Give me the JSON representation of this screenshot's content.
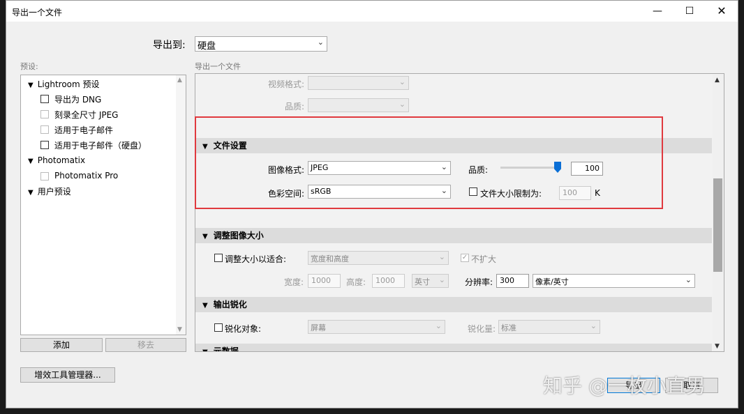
{
  "window": {
    "title": "导出一个文件",
    "minimize_icon": "minimize-icon",
    "maximize_icon": "maximize-icon",
    "close_icon": "close-icon"
  },
  "export_to": {
    "label": "导出到:",
    "value": "硬盘"
  },
  "presets": {
    "label": "预设:",
    "groups": [
      {
        "name": "Lightroom 预设",
        "items": [
          "导出为 DNG",
          "刻录全尺寸 JPEG",
          "适用于电子邮件",
          "适用于电子邮件（硬盘）"
        ]
      },
      {
        "name": "Photomatix",
        "items": [
          "Photomatix Pro"
        ]
      },
      {
        "name": "用户预设",
        "items": []
      }
    ],
    "add_button": "添加",
    "remove_button": "移去"
  },
  "settings": {
    "label": "导出一个文件",
    "video": {
      "format_label": "视频格式:",
      "quality_label": "品质:"
    },
    "file_settings": {
      "header": "文件设置",
      "image_format_label": "图像格式:",
      "image_format_value": "JPEG",
      "quality_label": "品质:",
      "quality_value": "100",
      "quality_level": 100,
      "color_space_label": "色彩空间:",
      "color_space_value": "sRGB",
      "limit_size_label": "文件大小限制为:",
      "limit_size_value": "100",
      "limit_size_unit": "K"
    },
    "resize": {
      "header": "调整图像大小",
      "fit_label": "调整大小以适合:",
      "fit_value": "宽度和高度",
      "dont_enlarge_label": "不扩大",
      "width_label": "宽度:",
      "width_value": "1000",
      "height_label": "高度:",
      "height_value": "1000",
      "unit_value": "英寸",
      "resolution_label": "分辨率:",
      "resolution_value": "300",
      "resolution_unit": "像素/英寸"
    },
    "sharpen": {
      "header": "输出锐化",
      "target_label": "锐化对象:",
      "target_value": "屏幕",
      "amount_label": "锐化量:",
      "amount_value": "标准"
    },
    "metadata": {
      "header": "元数据"
    }
  },
  "plugin_manager_button": "增效工具管理器...",
  "export_button": "导出",
  "cancel_button": "取消",
  "watermark": "知乎 @一枚小直男"
}
